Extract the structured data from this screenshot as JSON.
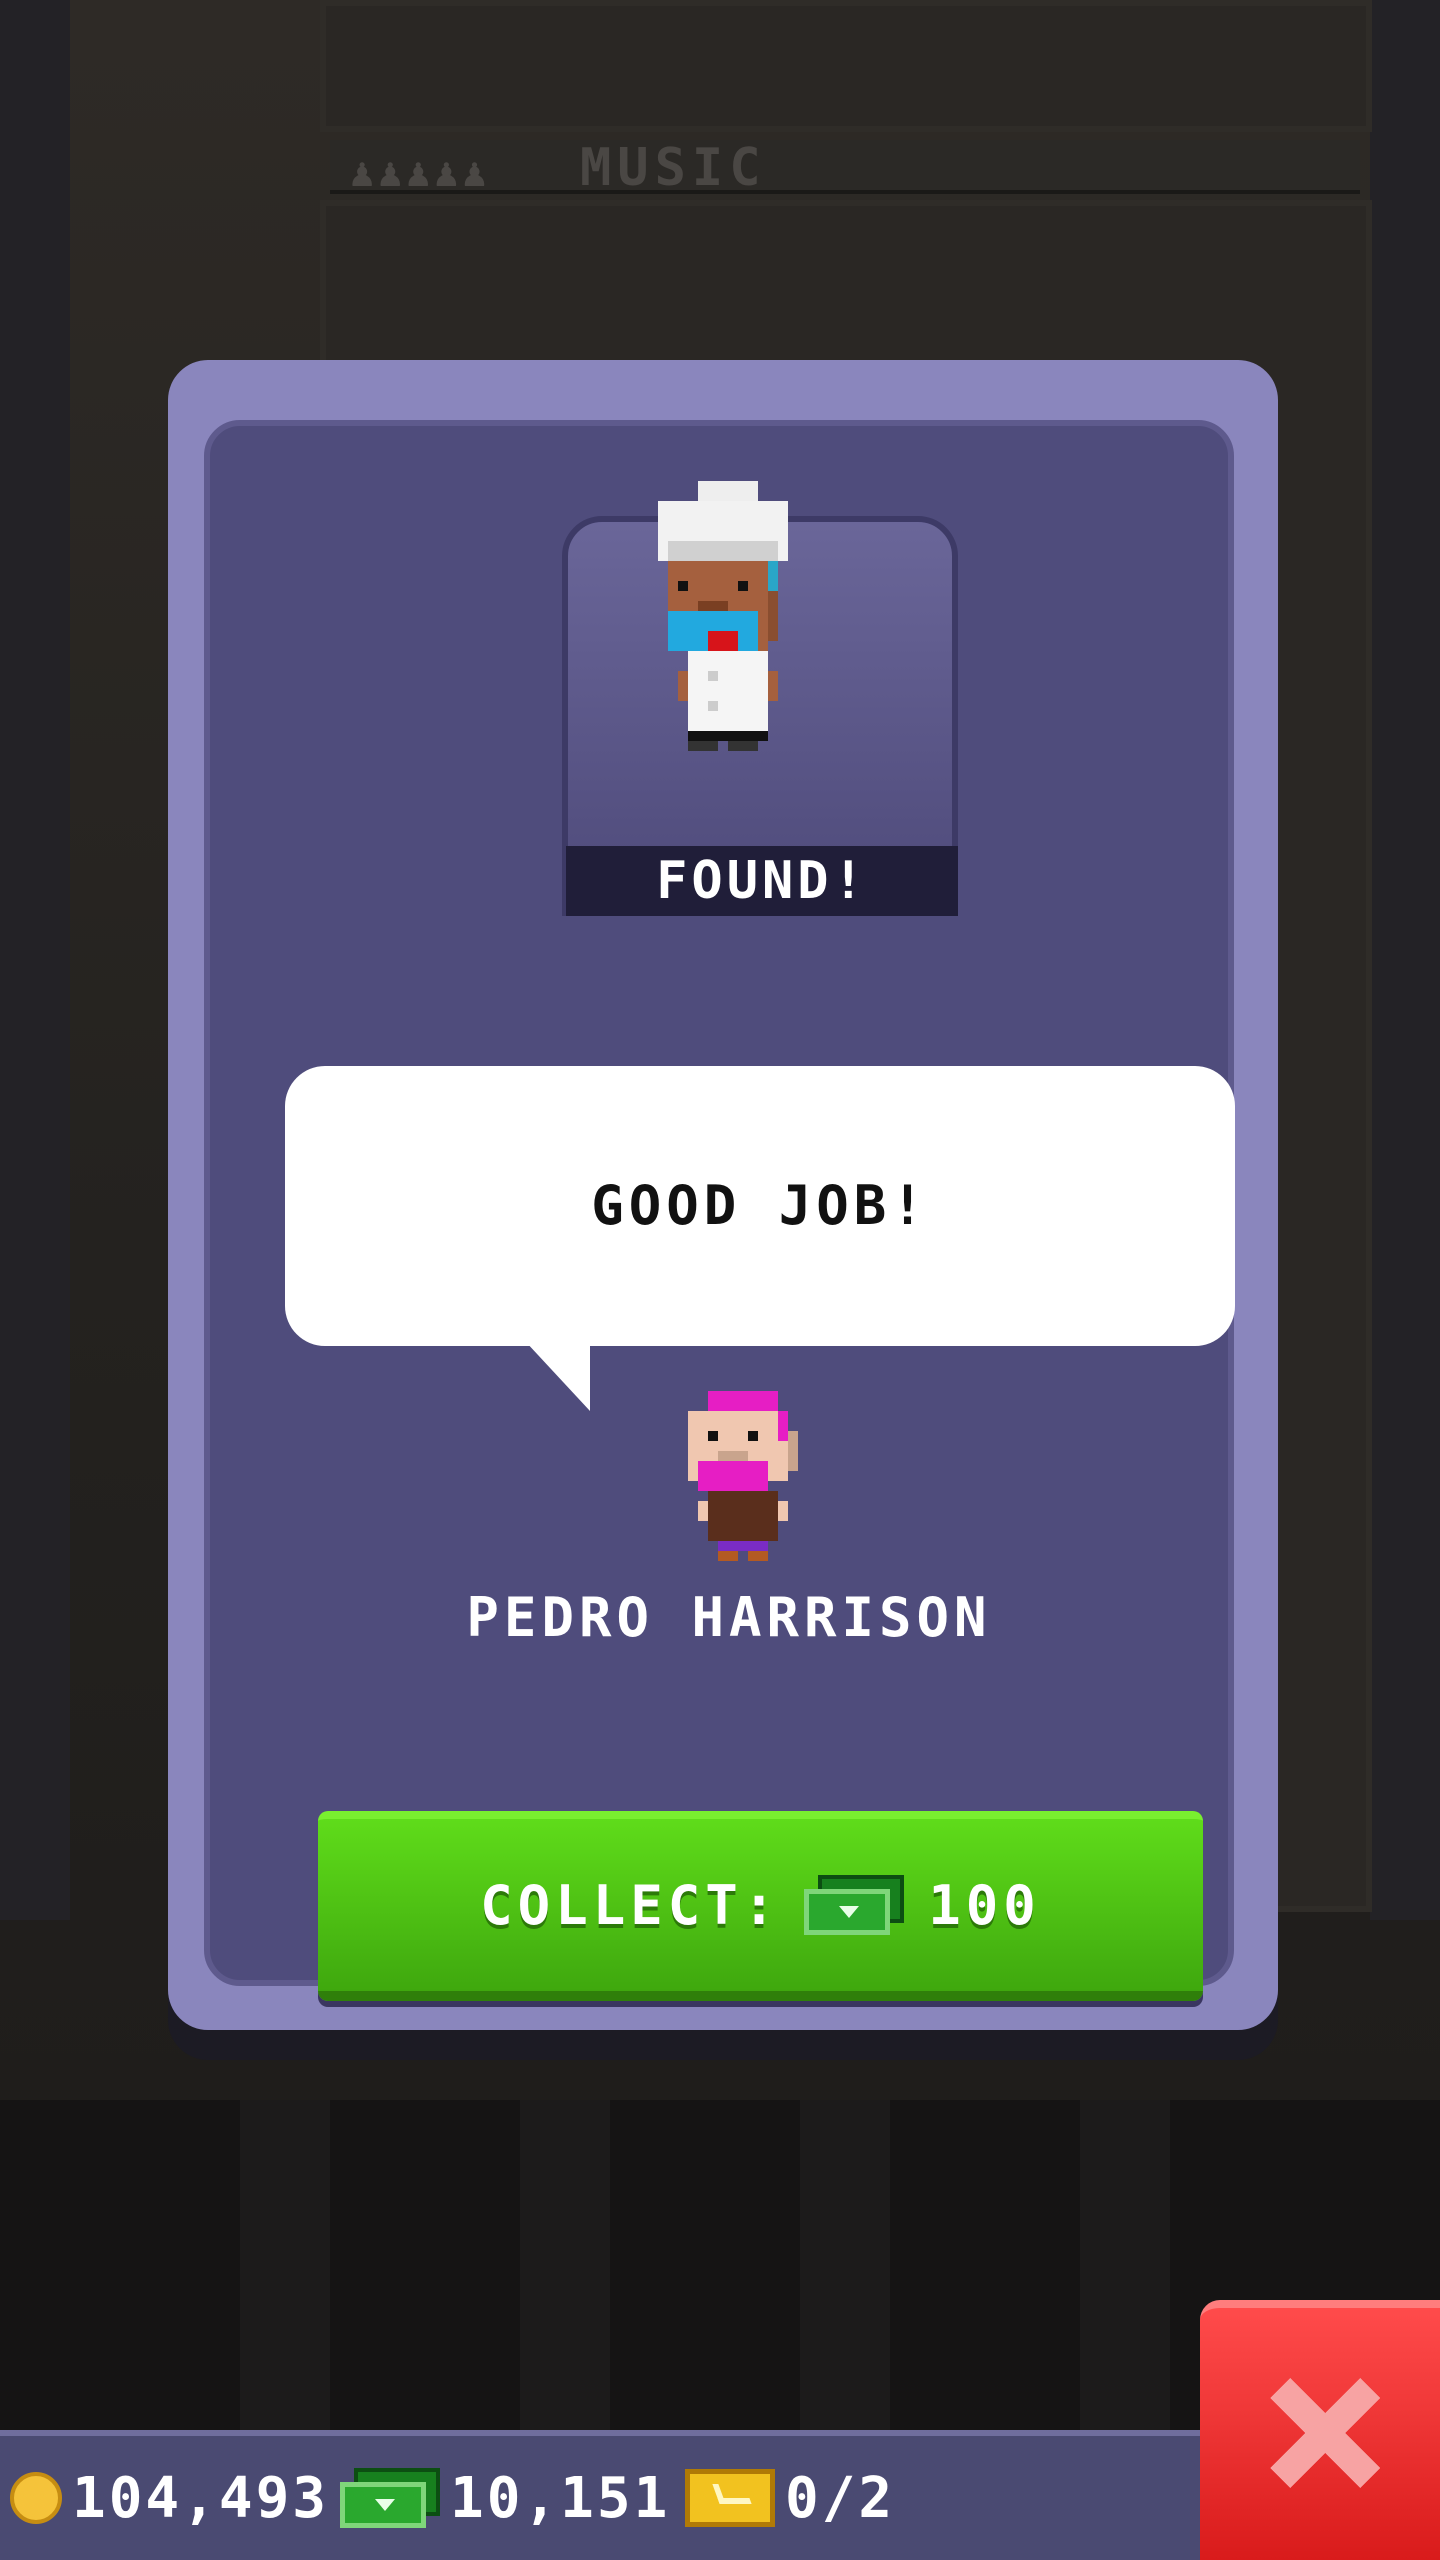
{
  "background": {
    "floor_sign": "MUSIC"
  },
  "modal": {
    "status_label": "FOUND!",
    "speech": "GOOD JOB!",
    "npc_name": "PEDRO HARRISON",
    "collect": {
      "label": "COLLECT:",
      "amount": "100",
      "currency_icon": "bux-icon"
    }
  },
  "hud": {
    "coins": "104,493",
    "bux": "10,151",
    "tickets": "0/2"
  },
  "icons": {
    "coins": "coin-icon",
    "bux": "bux-icon",
    "tickets": "ticket-icon",
    "close": "close-icon"
  },
  "colors": {
    "panel": "#4f4c7c",
    "panel_border": "#8a86bd",
    "collect_button": "#4cc314",
    "close_button": "#e62a2a",
    "hud": "#4a4a72"
  }
}
